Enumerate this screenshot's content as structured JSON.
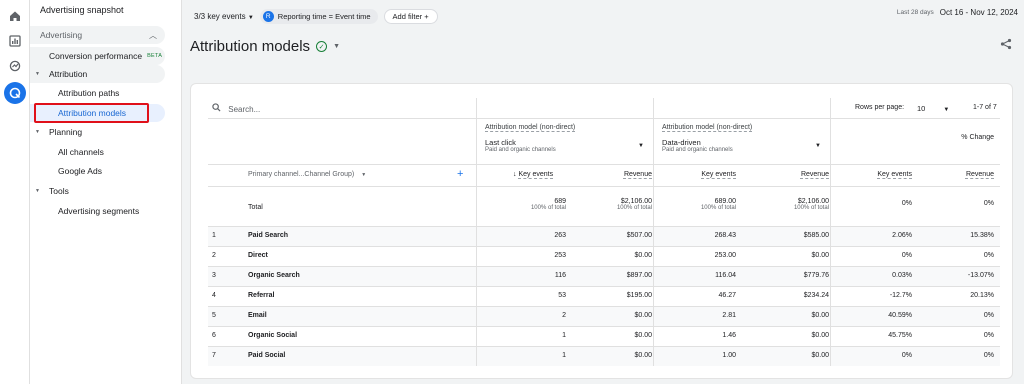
{
  "rail": [
    "home-icon",
    "reports-icon",
    "explore-icon",
    "advertising-icon"
  ],
  "sidebar": {
    "top_item": "Advertising snapshot",
    "section": "Advertising",
    "items": [
      {
        "label": "Conversion performance",
        "badge": "BETA"
      },
      {
        "label": "Attribution"
      },
      {
        "label": "Attribution paths"
      },
      {
        "label": "Attribution models"
      },
      {
        "label": "Planning"
      },
      {
        "label": "All channels"
      },
      {
        "label": "Google Ads"
      },
      {
        "label": "Tools"
      },
      {
        "label": "Advertising segments"
      }
    ]
  },
  "topbar": {
    "key_events": "3/3 key events",
    "chip_badge": "R",
    "chip_label": "Reporting time = Event time",
    "add_filter": "Add filter",
    "date_label": "Last 28 days",
    "date_range": "Oct 16 - Nov 12, 2024"
  },
  "page_title": "Attribution models",
  "table": {
    "search_placeholder": "Search...",
    "rows_per_page_label": "Rows per page:",
    "rows_per_page": "10",
    "pagination": "1-7 of 7",
    "model_label": "Attribution model (non-direct)",
    "model_a": "Last click",
    "model_a_sub": "Paid and organic channels",
    "model_b": "Data-driven",
    "model_b_sub": "Paid and organic channels",
    "pct_change": "% Change",
    "dimension": "Primary channel...Channel Group)",
    "col_key_events": "Key events",
    "col_revenue": "Revenue",
    "total_label": "Total",
    "total": {
      "a_ke": "689",
      "a_ke_sub": "100% of total",
      "a_rev": "$2,106.00",
      "a_rev_sub": "100% of total",
      "b_ke": "689.00",
      "b_ke_sub": "100% of total",
      "b_rev": "$2,106.00",
      "b_rev_sub": "100% of total",
      "c_ke": "0%",
      "c_rev": "0%"
    },
    "rows": [
      {
        "n": "1",
        "ch": "Paid Search",
        "a_ke": "263",
        "a_rev": "$507.00",
        "b_ke": "268.43",
        "b_rev": "$585.00",
        "c_ke": "2.06%",
        "c_rev": "15.38%"
      },
      {
        "n": "2",
        "ch": "Direct",
        "a_ke": "253",
        "a_rev": "$0.00",
        "b_ke": "253.00",
        "b_rev": "$0.00",
        "c_ke": "0%",
        "c_rev": "0%"
      },
      {
        "n": "3",
        "ch": "Organic Search",
        "a_ke": "116",
        "a_rev": "$897.00",
        "b_ke": "116.04",
        "b_rev": "$779.76",
        "c_ke": "0.03%",
        "c_rev": "-13.07%"
      },
      {
        "n": "4",
        "ch": "Referral",
        "a_ke": "53",
        "a_rev": "$195.00",
        "b_ke": "46.27",
        "b_rev": "$234.24",
        "c_ke": "-12.7%",
        "c_rev": "20.13%"
      },
      {
        "n": "5",
        "ch": "Email",
        "a_ke": "2",
        "a_rev": "$0.00",
        "b_ke": "2.81",
        "b_rev": "$0.00",
        "c_ke": "40.59%",
        "c_rev": "0%"
      },
      {
        "n": "6",
        "ch": "Organic Social",
        "a_ke": "1",
        "a_rev": "$0.00",
        "b_ke": "1.46",
        "b_rev": "$0.00",
        "c_ke": "45.75%",
        "c_rev": "0%"
      },
      {
        "n": "7",
        "ch": "Paid Social",
        "a_ke": "1",
        "a_rev": "$0.00",
        "b_ke": "1.00",
        "b_rev": "$0.00",
        "c_ke": "0%",
        "c_rev": "0%"
      }
    ]
  },
  "colors": {
    "accent": "#1a73e8",
    "highlight": "#e0101a",
    "selected_bg": "#e8f0fe"
  }
}
